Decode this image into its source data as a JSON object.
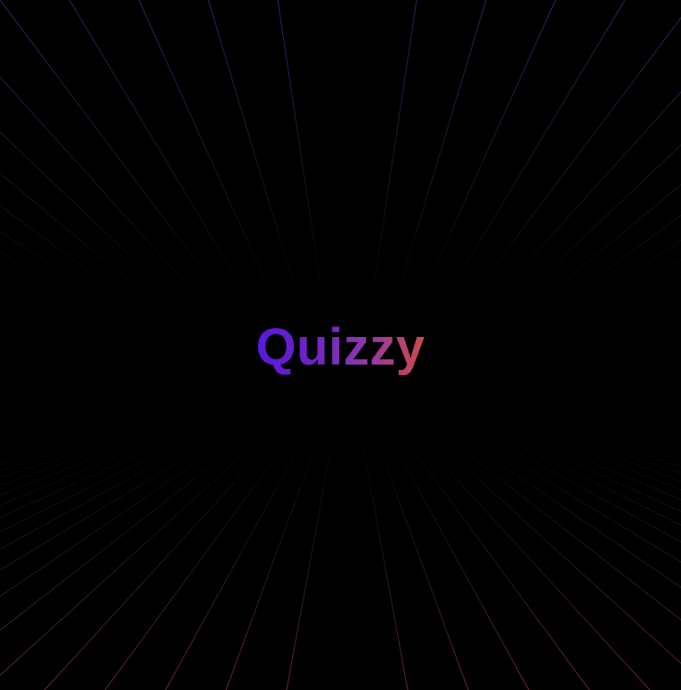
{
  "app": {
    "title": "Quizzy"
  },
  "theme": {
    "background": "#000000",
    "grid_top_color": "#3a2a72",
    "grid_bottom_color": "#7a2a3a",
    "logo_gradient": [
      "#5a17e0",
      "#6a22c6",
      "#8b36b0",
      "#cf4a4a"
    ]
  }
}
